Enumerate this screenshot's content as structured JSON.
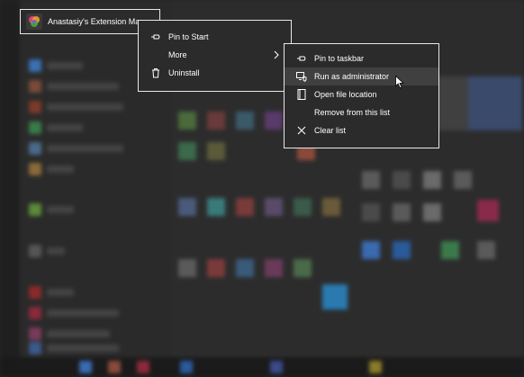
{
  "app": {
    "name": "Anastasiy's Extension Manager",
    "icon": "extension-manager-icon"
  },
  "context_menu": {
    "items": [
      {
        "label": "Pin to Start",
        "icon": "pin-icon"
      },
      {
        "label": "More",
        "icon": "",
        "has_submenu": true
      },
      {
        "label": "Uninstall",
        "icon": "trash-icon"
      }
    ]
  },
  "submenu": {
    "items": [
      {
        "label": "Pin to taskbar",
        "icon": "pin-icon"
      },
      {
        "label": "Run as administrator",
        "icon": "run-as-admin-icon",
        "highlighted": true
      },
      {
        "label": "Open file location",
        "icon": "file-location-icon"
      },
      {
        "label": "Remove from this list",
        "icon": ""
      },
      {
        "label": "Clear list",
        "icon": "close-icon"
      }
    ]
  },
  "colors": {
    "menu_bg": "#2b2b2b",
    "menu_border": "#e8e8e8",
    "hover_bg": "#404040",
    "text": "#ffffff"
  }
}
